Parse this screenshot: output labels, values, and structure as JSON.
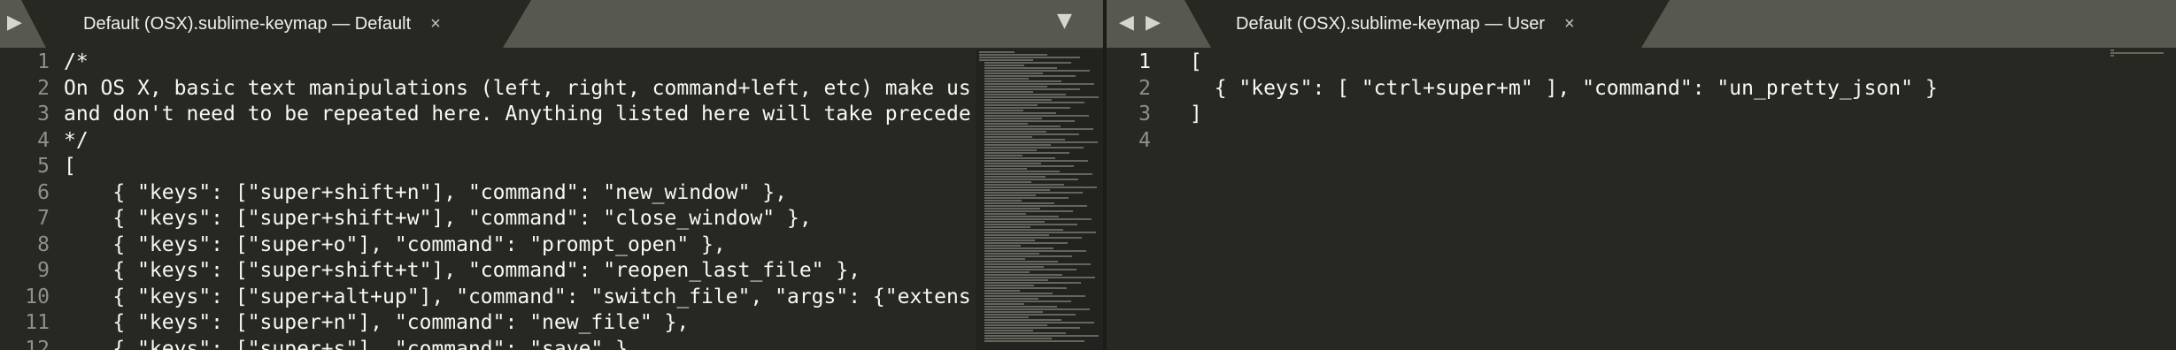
{
  "colors": {
    "background": "#272822",
    "tabbar": "#57584f",
    "comment": "#75715e",
    "text": "#f8f8f2",
    "line_number": "#8f908a"
  },
  "left_pane": {
    "tab": {
      "title": "Default (OSX).sublime-keymap — Default",
      "close_icon": "×"
    },
    "controls": {
      "sidebar_toggle": "▶",
      "tab_menu": "▼"
    },
    "lines": [
      {
        "no": "1",
        "text": "/*",
        "kind": "comment"
      },
      {
        "no": "2",
        "text": "On OS X, basic text manipulations (left, right, command+left, etc) make us",
        "kind": "comment"
      },
      {
        "no": "3",
        "text": "and don't need to be repeated here. Anything listed here will take precede",
        "kind": "comment"
      },
      {
        "no": "4",
        "text": "*/",
        "kind": "comment"
      },
      {
        "no": "5",
        "text": "[",
        "kind": "code"
      },
      {
        "no": "6",
        "text": "    { \"keys\": [\"super+shift+n\"], \"command\": \"new_window\" },",
        "kind": "code"
      },
      {
        "no": "7",
        "text": "    { \"keys\": [\"super+shift+w\"], \"command\": \"close_window\" },",
        "kind": "code"
      },
      {
        "no": "8",
        "text": "    { \"keys\": [\"super+o\"], \"command\": \"prompt_open\" },",
        "kind": "code"
      },
      {
        "no": "9",
        "text": "    { \"keys\": [\"super+shift+t\"], \"command\": \"reopen_last_file\" },",
        "kind": "code"
      },
      {
        "no": "10",
        "text": "    { \"keys\": [\"super+alt+up\"], \"command\": \"switch_file\", \"args\": {\"extens",
        "kind": "code"
      },
      {
        "no": "11",
        "text": "    { \"keys\": [\"super+n\"], \"command\": \"new_file\" },",
        "kind": "code"
      },
      {
        "no": "12",
        "text": "    { \"keys\": [\"super+s\"], \"command\": \"save\" },",
        "kind": "code"
      }
    ]
  },
  "right_pane": {
    "tab": {
      "title": "Default (OSX).sublime-keymap — User",
      "close_icon": "×"
    },
    "controls": {
      "prev_tab": "◀",
      "next_tab": "▶"
    },
    "lines": [
      {
        "no": "1",
        "text": "[",
        "kind": "code"
      },
      {
        "no": "2",
        "text": "  { \"keys\": [ \"ctrl+super+m\" ], \"command\": \"un_pretty_json\" }",
        "kind": "code"
      },
      {
        "no": "3",
        "text": "]",
        "kind": "code"
      },
      {
        "no": "4",
        "text": "",
        "kind": "code"
      }
    ]
  }
}
